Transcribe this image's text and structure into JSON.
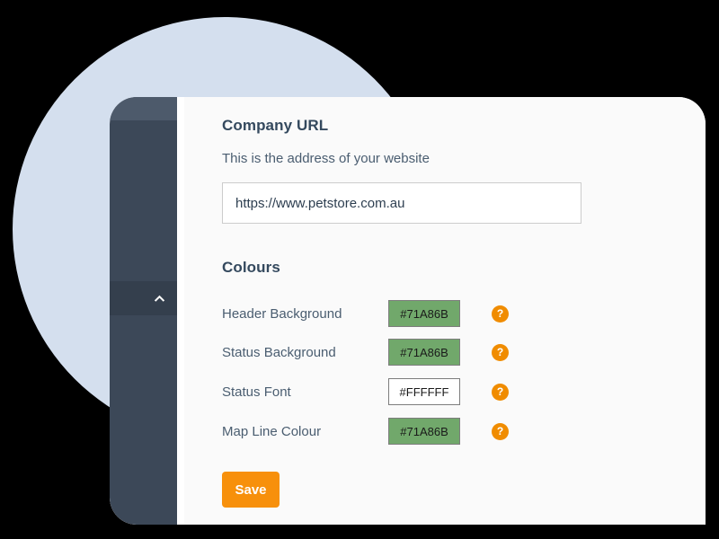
{
  "theme": {
    "page_background": "#000000",
    "decor_circle_color": "#d4dfee",
    "card_background": "#ffffff",
    "content_background": "#fafafa",
    "sidebar_color": "#3c4858",
    "sidebar_top_band_color": "#4d5a6b",
    "sidebar_active_row_color": "#343f4d",
    "accent_orange": "#f7900b",
    "help_icon_color": "#f08c00",
    "heading_color": "#34495e",
    "label_color": "#4a5d70",
    "swatch_green": "#71a86b"
  },
  "sidebar": {
    "collapse_icon": "chevron-up-icon"
  },
  "company_url": {
    "heading": "Company URL",
    "help_text": "This is the address of your website",
    "input_value": "https://www.petstore.com.au",
    "input_placeholder": "https://"
  },
  "colours": {
    "heading": "Colours",
    "rows": [
      {
        "label": "Header Background",
        "value": "#71A86B",
        "swatch_background": "#71a86b",
        "swatch_text_color": "#1a1a1a",
        "help_icon": "question-mark-icon",
        "help_label": "?"
      },
      {
        "label": "Status Background",
        "value": "#71A86B",
        "swatch_background": "#71a86b",
        "swatch_text_color": "#1a1a1a",
        "help_icon": "question-mark-icon",
        "help_label": "?"
      },
      {
        "label": "Status Font",
        "value": "#FFFFFF",
        "swatch_background": "#ffffff",
        "swatch_text_color": "#1a1a1a",
        "help_icon": "question-mark-icon",
        "help_label": "?"
      },
      {
        "label": "Map Line Colour",
        "value": "#71A86B",
        "swatch_background": "#71a86b",
        "swatch_text_color": "#1a1a1a",
        "help_icon": "question-mark-icon",
        "help_label": "?"
      }
    ]
  },
  "actions": {
    "save_label": "Save"
  }
}
